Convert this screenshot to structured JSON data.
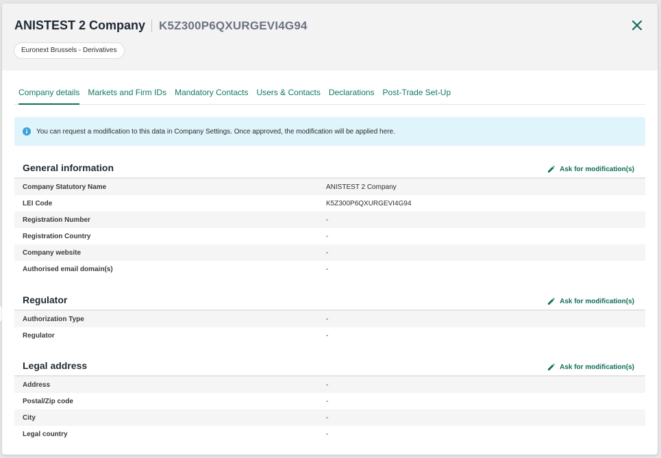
{
  "header": {
    "company_name": "ANISTEST 2 Company",
    "lei": "K5Z300P6QXURGEVI4G94",
    "market_chip": "Euronext Brussels - Derivatives"
  },
  "tabs": [
    {
      "label": "Company details",
      "active": true
    },
    {
      "label": "Markets and Firm IDs",
      "active": false
    },
    {
      "label": "Mandatory Contacts",
      "active": false
    },
    {
      "label": "Users & Contacts",
      "active": false
    },
    {
      "label": "Declarations",
      "active": false
    },
    {
      "label": "Post-Trade Set-Up",
      "active": false
    }
  ],
  "info_banner": "You can request a modification to this data in Company Settings. Once approved, the modification will be applied here.",
  "modify_label": "Ask for modification(s)",
  "sections": {
    "general": {
      "title": "General information",
      "rows": [
        {
          "label": "Company Statutory Name",
          "value": "ANISTEST 2 Company"
        },
        {
          "label": "LEI Code",
          "value": "K5Z300P6QXURGEVI4G94"
        },
        {
          "label": "Registration Number",
          "value": "-"
        },
        {
          "label": "Registration Country",
          "value": "-"
        },
        {
          "label": "Company website",
          "value": "-"
        },
        {
          "label": "Authorised email domain(s)",
          "value": "-"
        }
      ]
    },
    "regulator": {
      "title": "Regulator",
      "rows": [
        {
          "label": "Authorization Type",
          "value": "-"
        },
        {
          "label": "Regulator",
          "value": "-"
        }
      ]
    },
    "legal": {
      "title": "Legal address",
      "rows": [
        {
          "label": "Address",
          "value": "-"
        },
        {
          "label": "Postal/Zip code",
          "value": "-"
        },
        {
          "label": "City",
          "value": "-"
        },
        {
          "label": "Legal country",
          "value": "-"
        }
      ]
    }
  },
  "colors": {
    "accent": "#0f6e58",
    "header_bg": "#f3f3f3",
    "info_bg": "#dff4fb",
    "info_icon": "#3aa0d8"
  },
  "icons": {
    "close": "close-icon",
    "info": "info-icon",
    "edit": "pencil-icon"
  }
}
